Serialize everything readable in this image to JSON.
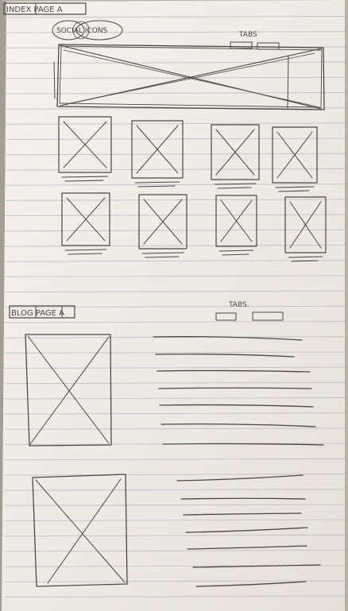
{
  "sketch": {
    "index_page_label": "INDEX PAGE A",
    "social_icons_label": "SOCIAL ICONS",
    "index_tabs_label": "TABS",
    "blog_page_label": "BLOG PAGE A",
    "blog_tabs_label": "TABS."
  },
  "colors": {
    "paper": "#f1ebe6",
    "ink": "#4c4744",
    "ruled_line": "#c9c4cc",
    "background": "#b7b0a4"
  }
}
